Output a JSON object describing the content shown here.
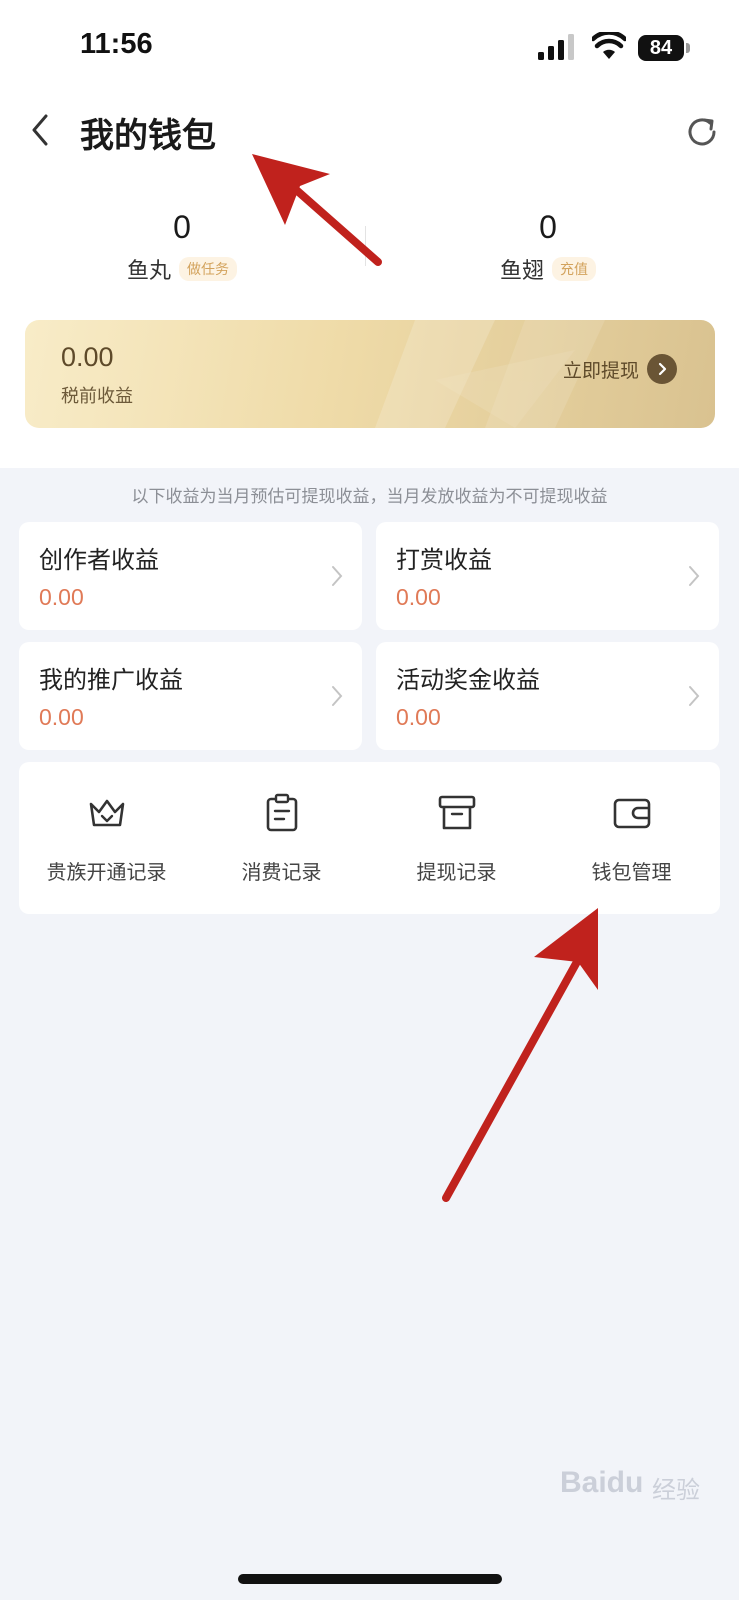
{
  "status_bar": {
    "time": "11:56",
    "battery": "84"
  },
  "header": {
    "title": "我的钱包"
  },
  "balances": [
    {
      "value": "0",
      "label": "鱼丸",
      "tag": "做任务"
    },
    {
      "value": "0",
      "label": "鱼翅",
      "tag": "充值"
    }
  ],
  "gold_card": {
    "amount": "0.00",
    "label": "税前收益",
    "withdraw_label": "立即提现"
  },
  "notice": "以下收益为当月预估可提现收益，当月发放收益为不可提现收益",
  "earnings": [
    {
      "title": "创作者收益",
      "value": "0.00"
    },
    {
      "title": "打赏收益",
      "value": "0.00"
    },
    {
      "title": "我的推广收益",
      "value": "0.00"
    },
    {
      "title": "活动奖金收益",
      "value": "0.00"
    }
  ],
  "records": [
    {
      "label": "贵族开通记录",
      "icon": "crown-icon"
    },
    {
      "label": "消费记录",
      "icon": "clipboard-icon"
    },
    {
      "label": "提现记录",
      "icon": "archive-icon"
    },
    {
      "label": "钱包管理",
      "icon": "wallet-icon"
    }
  ],
  "colors": {
    "accent_orange": "#e07a57",
    "gold_card": "#efdba8",
    "annotation_arrow": "#c0221d",
    "page_bg": "#f2f4f9"
  },
  "watermark": {
    "brand": "Baidu",
    "suffix": "经验"
  }
}
